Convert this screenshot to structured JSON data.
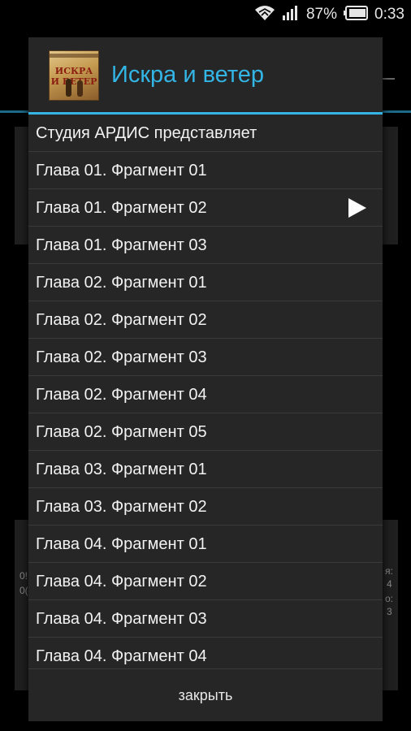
{
  "status_bar": {
    "battery_percent": "87%",
    "time": "0:33",
    "icons": [
      "wifi-icon",
      "signal-icon",
      "battery-icon"
    ]
  },
  "background_app": {
    "left_texts": [
      "0!",
      "0("
    ],
    "right_texts": [
      "я:",
      "4",
      "о:",
      "3"
    ]
  },
  "dialog": {
    "title": "Искра и ветер",
    "cover_text": "ИСКРА И ВЕТЕР",
    "accent_color": "#33b5e5",
    "items": [
      {
        "label": "Студия АРДИС представляет",
        "playing": false
      },
      {
        "label": "Глава 01. Фрагмент 01",
        "playing": false
      },
      {
        "label": "Глава 01. Фрагмент 02",
        "playing": true
      },
      {
        "label": "Глава 01. Фрагмент 03",
        "playing": false
      },
      {
        "label": "Глава 02. Фрагмент 01",
        "playing": false
      },
      {
        "label": "Глава 02. Фрагмент 02",
        "playing": false
      },
      {
        "label": "Глава 02. Фрагмент 03",
        "playing": false
      },
      {
        "label": "Глава 02. Фрагмент 04",
        "playing": false
      },
      {
        "label": "Глава 02. Фрагмент 05",
        "playing": false
      },
      {
        "label": "Глава 03. Фрагмент 01",
        "playing": false
      },
      {
        "label": "Глава 03. Фрагмент 02",
        "playing": false
      },
      {
        "label": "Глава 04. Фрагмент 01",
        "playing": false
      },
      {
        "label": "Глава 04. Фрагмент 02",
        "playing": false
      },
      {
        "label": "Глава 04. Фрагмент 03",
        "playing": false
      },
      {
        "label": "Глава 04. Фрагмент 04",
        "playing": false
      }
    ],
    "close_label": "закрыть"
  }
}
